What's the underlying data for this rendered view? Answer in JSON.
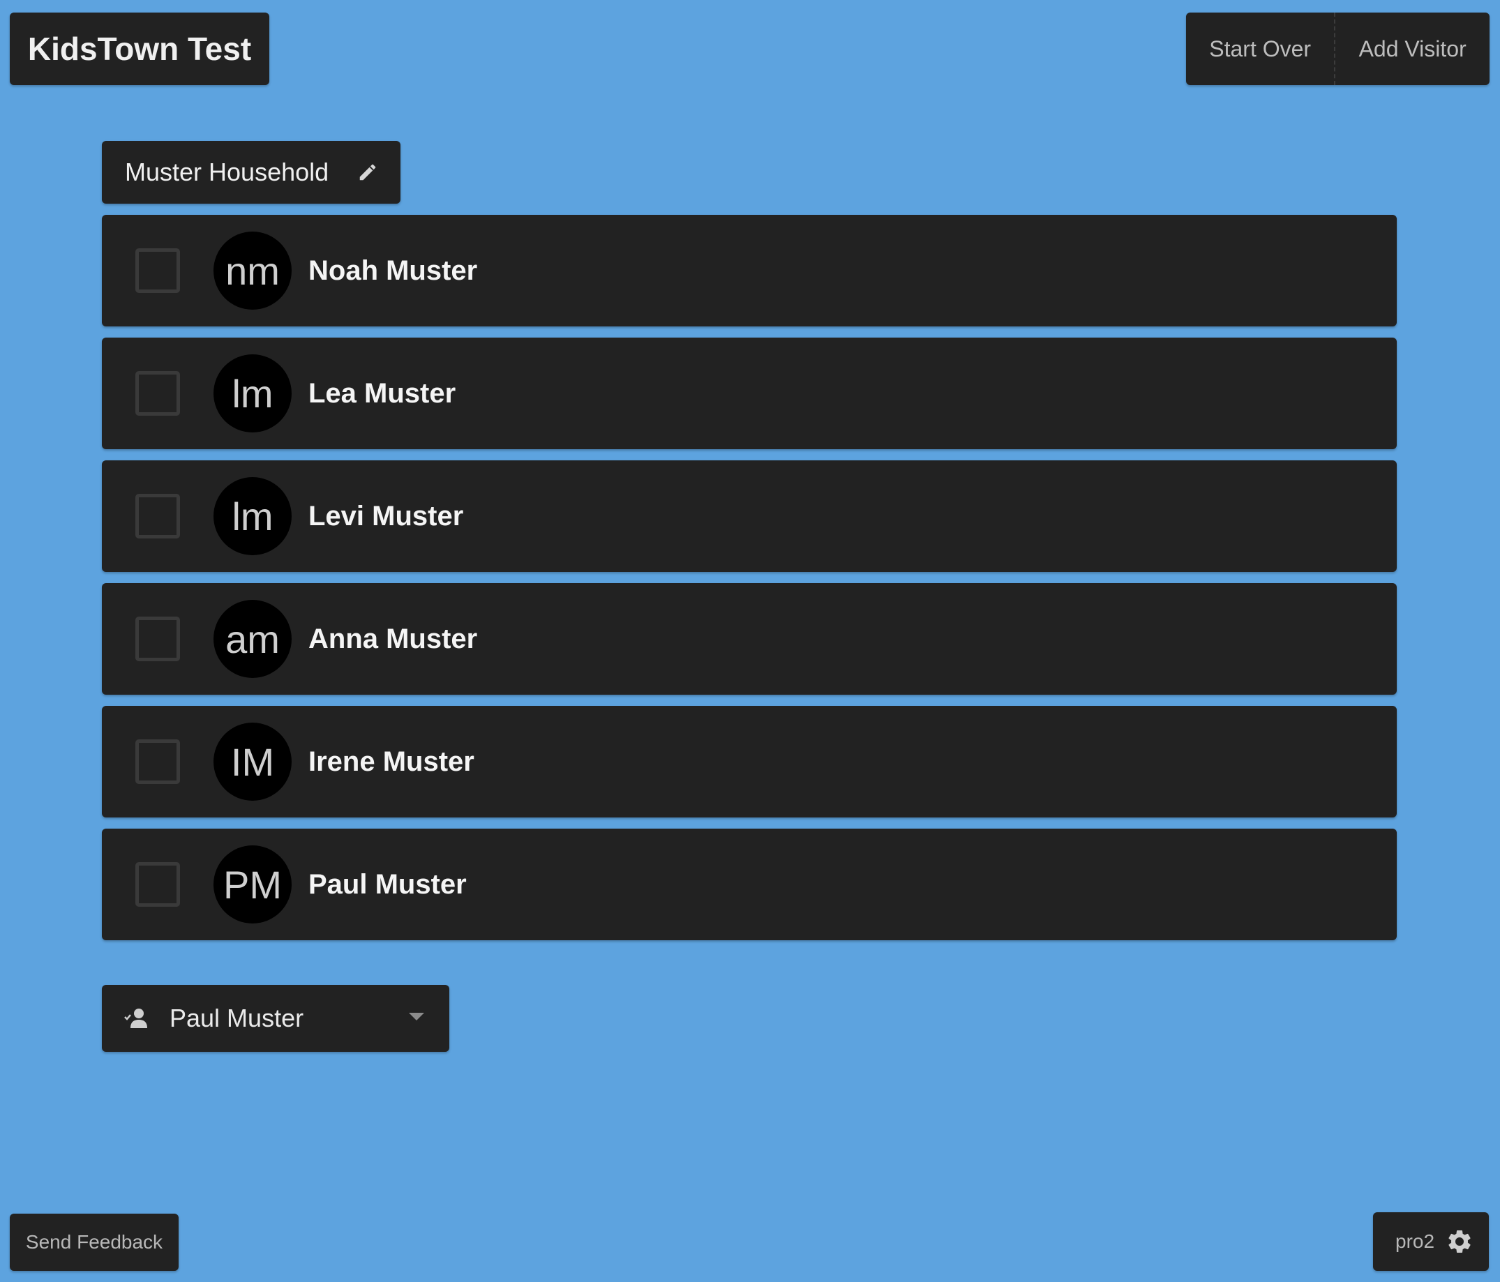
{
  "header": {
    "app_title": "KidsTown Test",
    "start_over_label": "Start Over",
    "add_visitor_label": "Add Visitor"
  },
  "household": {
    "name": "Muster Household",
    "edit_icon": "pencil-icon"
  },
  "members": [
    {
      "initials": "nm",
      "name": "Noah Muster",
      "checked": false
    },
    {
      "initials": "lm",
      "name": "Lea Muster",
      "checked": false
    },
    {
      "initials": "lm",
      "name": "Levi Muster",
      "checked": false
    },
    {
      "initials": "am",
      "name": "Anna Muster",
      "checked": false
    },
    {
      "initials": "IM",
      "name": "Irene Muster",
      "checked": false
    },
    {
      "initials": "PM",
      "name": "Paul Muster",
      "checked": false
    }
  ],
  "guardian_select": {
    "icon": "person-check-icon",
    "selected": "Paul Muster"
  },
  "footer": {
    "feedback_label": "Send Feedback",
    "station_label": "pro2",
    "settings_icon": "gear-icon"
  },
  "colors": {
    "background": "#5da3df",
    "panel": "#222222",
    "avatar": "#000000"
  }
}
